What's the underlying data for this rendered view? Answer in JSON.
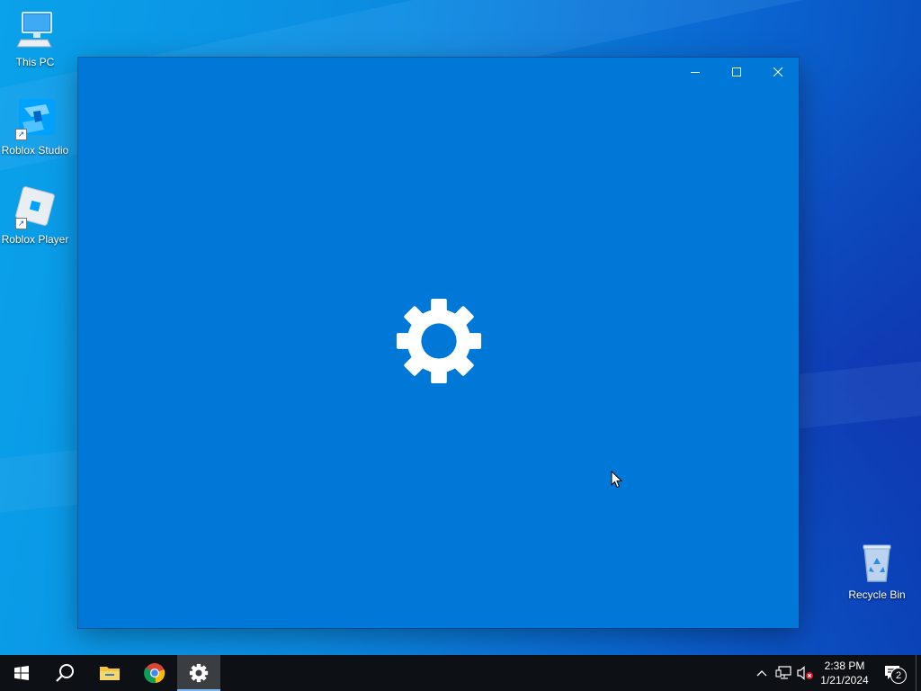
{
  "desktop": {
    "icons": [
      {
        "label": "This PC",
        "icon": "computer-icon"
      },
      {
        "label": "Roblox Studio",
        "icon": "roblox-studio-icon",
        "shortcut": true
      },
      {
        "label": "Roblox Player",
        "icon": "roblox-player-icon",
        "shortcut": true
      },
      {
        "label": "Recycle Bin",
        "icon": "recycle-bin-icon"
      }
    ]
  },
  "window": {
    "app": "Settings",
    "splash_icon": "gear-icon",
    "background": "#0078d7",
    "controls": [
      "minimize",
      "maximize",
      "close"
    ]
  },
  "taskbar": {
    "pinned": [
      {
        "name": "start",
        "icon": "windows-logo-icon"
      },
      {
        "name": "search",
        "icon": "search-icon"
      },
      {
        "name": "file-explorer",
        "icon": "folder-icon"
      },
      {
        "name": "chrome",
        "icon": "chrome-icon"
      },
      {
        "name": "settings",
        "icon": "gear-icon",
        "active": true
      }
    ],
    "tray": {
      "icons": [
        "chevron-up-icon",
        "network-icon",
        "volume-muted-icon"
      ],
      "time": "2:38 PM",
      "date": "1/21/2024",
      "notification_count": "2"
    }
  },
  "colors": {
    "accent": "#0078d7",
    "taskbar": "#0d1014",
    "active_indicator": "#7ab4ea"
  }
}
